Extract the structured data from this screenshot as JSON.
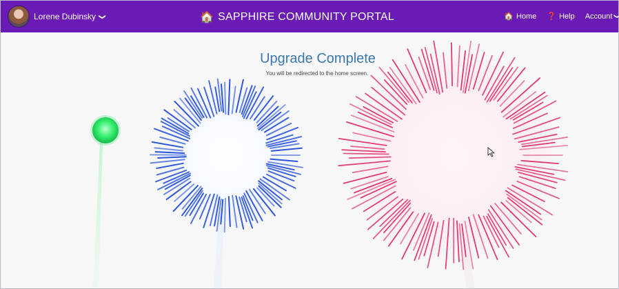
{
  "navbar": {
    "user_name": "Lorene Dubinsky",
    "chevron_glyph": "❯",
    "portal_icon_glyph": "🏠",
    "portal_title": "SAPPHIRE COMMUNITY PORTAL",
    "links": [
      {
        "label": "Home",
        "icon": "home-icon",
        "glyph": "🏠"
      },
      {
        "label": "Help",
        "icon": "help-icon",
        "glyph": "❓"
      },
      {
        "label": "Account",
        "icon": "chevron-down-icon",
        "glyph": ""
      }
    ],
    "colors": {
      "bar": "#6a1bb5",
      "text": "#ffffff"
    }
  },
  "main": {
    "heading": "Upgrade Complete",
    "subtext": "You will be redirected to the home screen.",
    "background": "#f7f7f7",
    "heading_color": "#3b77b0"
  },
  "fireworks": [
    {
      "name": "green-rocket",
      "color": "#33ee66"
    },
    {
      "name": "blue-burst",
      "color": "#2b54d8"
    },
    {
      "name": "pink-burst",
      "color": "#e0376d"
    }
  ]
}
